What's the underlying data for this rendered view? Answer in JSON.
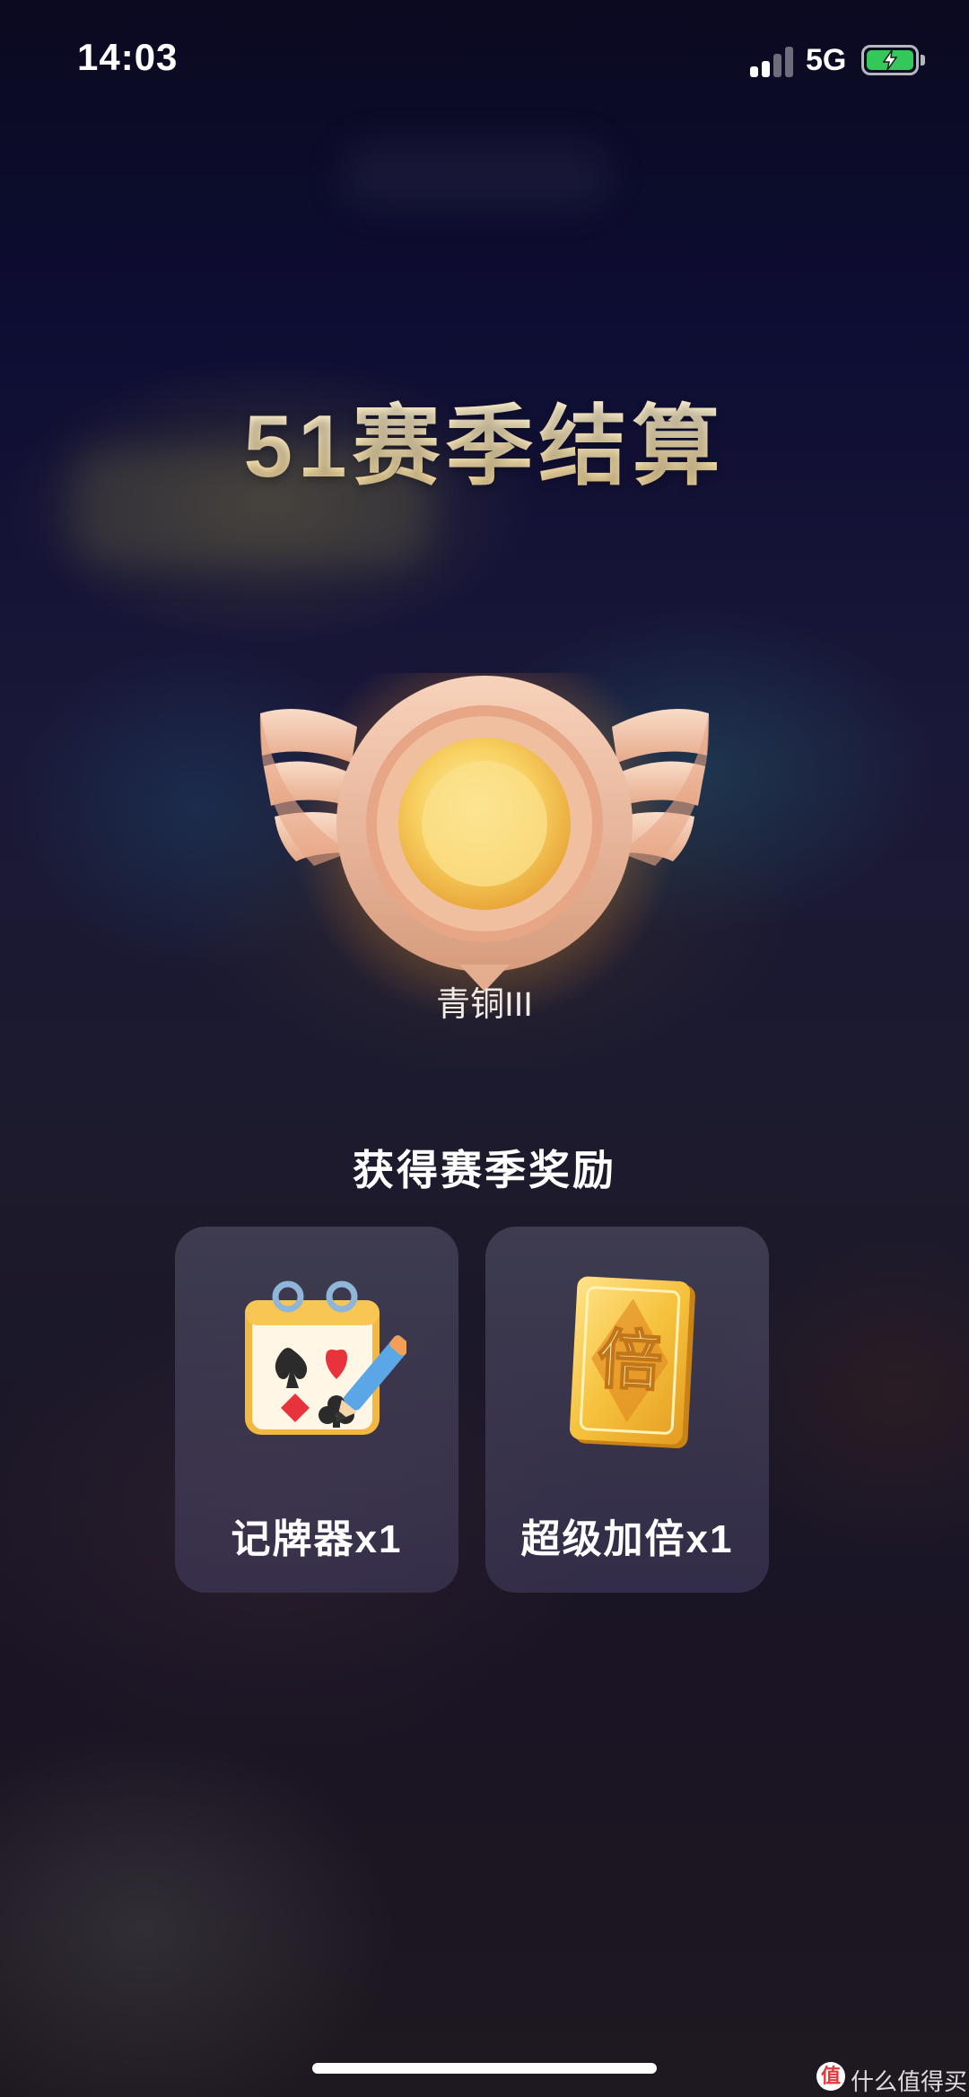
{
  "status_bar": {
    "time": "14:03",
    "network": "5G",
    "battery_charging": true
  },
  "page": {
    "title": "51赛季结算",
    "rank": "青铜III",
    "rewards_title": "获得赛季奖励"
  },
  "rewards": [
    {
      "label": "记牌器x1",
      "icon": "card-counter-icon"
    },
    {
      "label": "超级加倍x1",
      "icon": "super-double-card-icon"
    }
  ],
  "reward_icons": {
    "double_char": "倍"
  },
  "watermark": {
    "text": "什么值得买",
    "icon_char": "值"
  },
  "colors": {
    "title": "#fff3cf",
    "badge_gold": "#f5c65a",
    "badge_bronze": "#e9b69a",
    "battery": "#34c759"
  }
}
